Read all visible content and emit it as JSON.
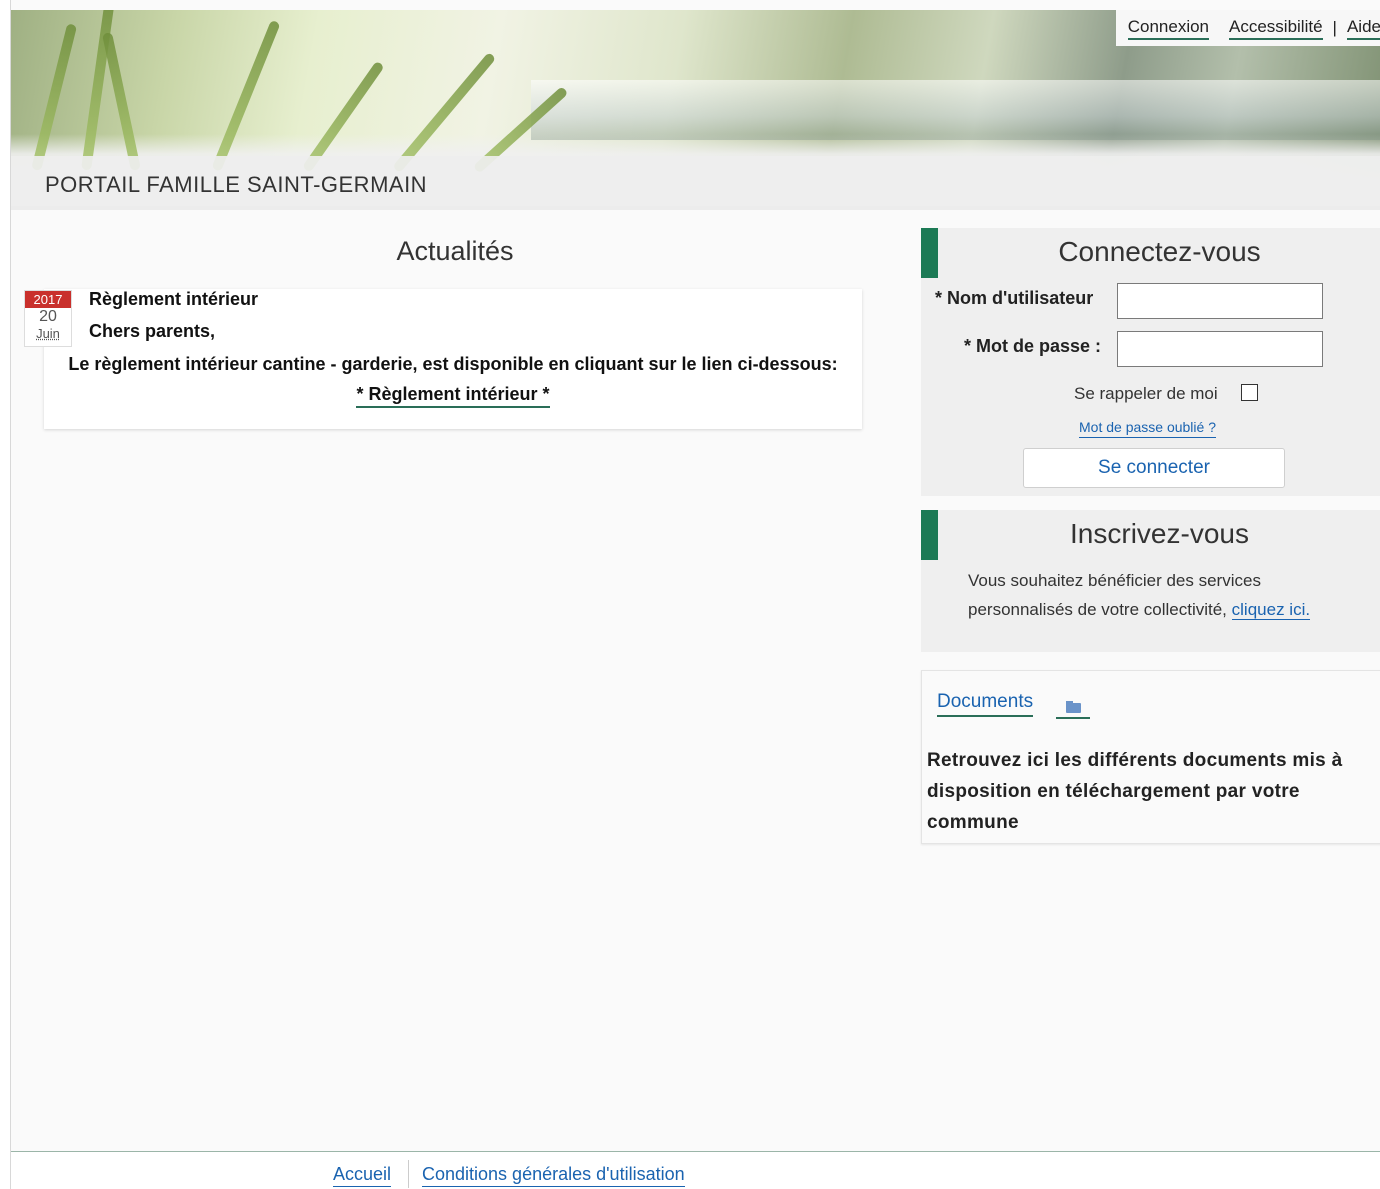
{
  "header": {
    "portal_title": "PORTAIL FAMILLE SAINT-GERMAIN",
    "nav": {
      "login": "Connexion",
      "accessibility": "Accessibilité",
      "separator": "|",
      "help": "Aide"
    }
  },
  "news": {
    "section_title": "Actualités",
    "item": {
      "year": "2017",
      "day": "20",
      "month": "Juin",
      "title": "Règlement intérieur",
      "greeting": "Chers parents,",
      "body": "Le règlement intérieur cantine - garderie, est disponible en cliquant sur le lien ci-dessous:",
      "link": "* Règlement intérieur *"
    }
  },
  "login": {
    "title": "Connectez-vous",
    "username_label": "* Nom d'utilisateur",
    "password_label": "* Mot de passe :",
    "username_value": "",
    "password_value": "",
    "remember_label": "Se rappeler de moi",
    "forgot_link": "Mot de passe oublié ?",
    "submit": "Se connecter"
  },
  "signup": {
    "title": "Inscrivez-vous",
    "text": "Vous souhaitez bénéficier des services personnalisés de votre collectivité,",
    "link": "cliquez ici."
  },
  "documents": {
    "tab_label": "Documents",
    "description": "Retrouvez ici les différents documents mis à disposition en téléchargement par votre commune"
  },
  "footer": {
    "home": "Accueil",
    "terms": "Conditions générales d'utilisation"
  },
  "colors": {
    "accent": "#1c7a55",
    "link": "#1a63b0",
    "date_badge": "#c9302c"
  }
}
